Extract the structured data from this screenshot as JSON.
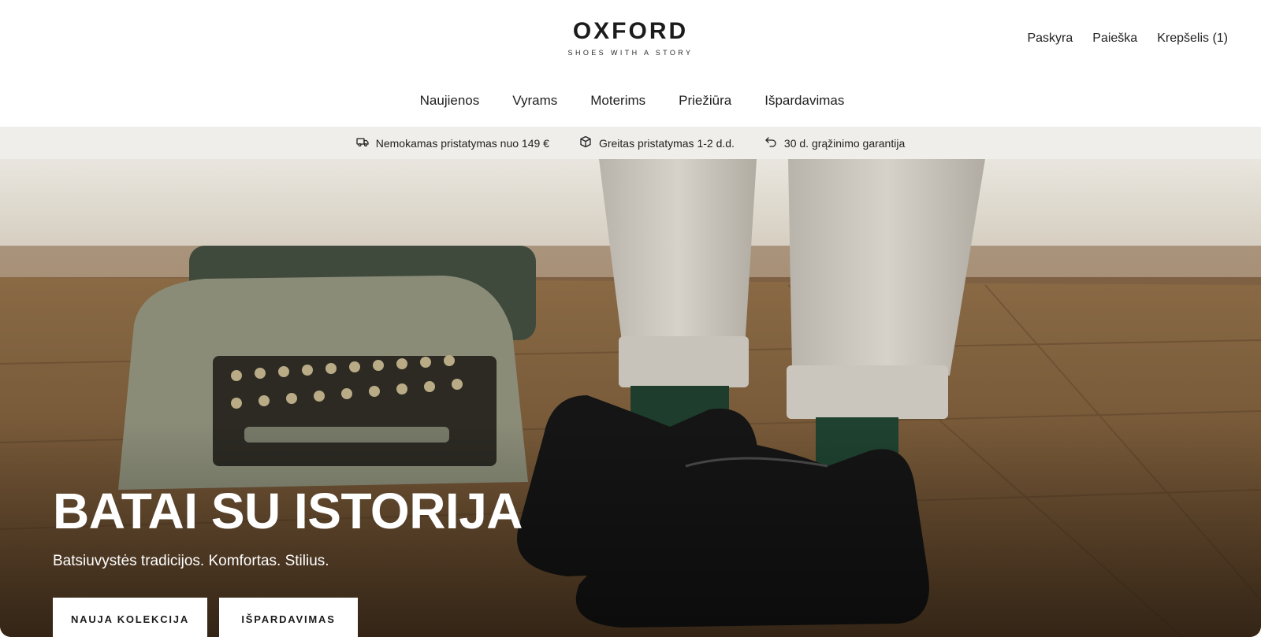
{
  "brand": {
    "name": "OXFORD",
    "tagline": "SHOES WITH A STORY"
  },
  "utility_nav": {
    "account": "Paskyra",
    "search": "Paieška",
    "cart": "Krepšelis (1)"
  },
  "main_nav": [
    {
      "label": "Naujienos"
    },
    {
      "label": "Vyrams"
    },
    {
      "label": "Moterims"
    },
    {
      "label": "Priežiūra"
    },
    {
      "label": "Išpardavimas"
    }
  ],
  "usp_bar": [
    {
      "icon": "truck-icon",
      "text": "Nemokamas pristatymas nuo 149 €"
    },
    {
      "icon": "box-icon",
      "text": "Greitas pristatymas 1-2 d.d."
    },
    {
      "icon": "return-arrow-icon",
      "text": "30 d. grąžinimo garantija"
    }
  ],
  "hero": {
    "title": "BATAI SU ISTORIJA",
    "subtitle": "Batsiuvystės tradicijos. Komfortas. Stilius.",
    "primary_cta": "NAUJA KOLEKCIJA",
    "secondary_cta": "IŠPARDAVIMAS"
  },
  "colors": {
    "usp_background": "#efeeea",
    "cta_background": "#ffffff",
    "text": "#1f1f1f"
  }
}
